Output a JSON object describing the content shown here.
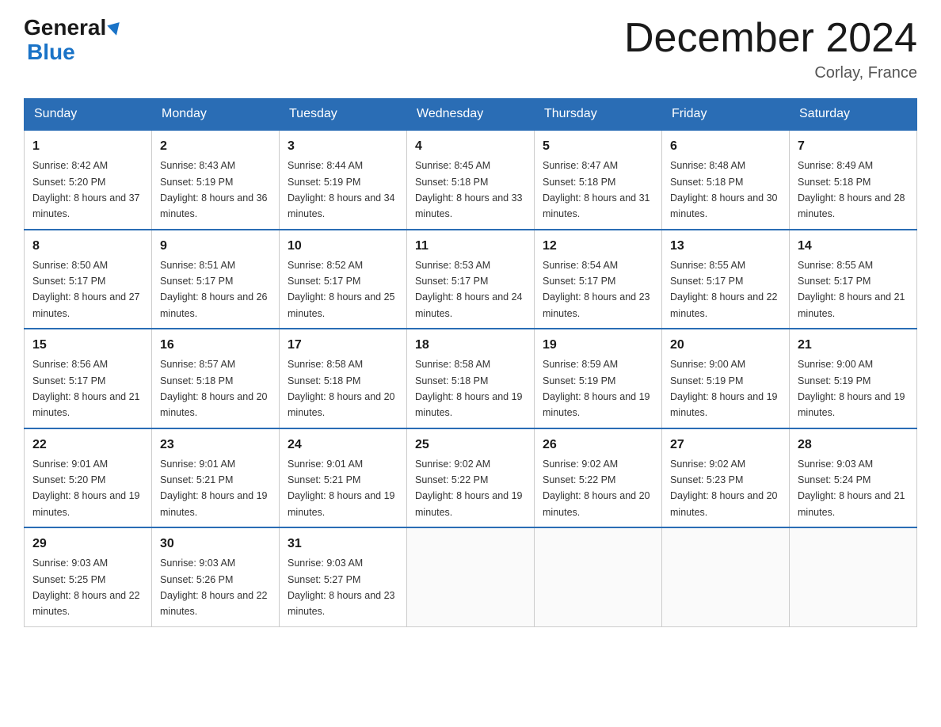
{
  "logo": {
    "general": "General",
    "blue": "Blue"
  },
  "title": "December 2024",
  "location": "Corlay, France",
  "days_header": [
    "Sunday",
    "Monday",
    "Tuesday",
    "Wednesday",
    "Thursday",
    "Friday",
    "Saturday"
  ],
  "weeks": [
    [
      {
        "day": "1",
        "sunrise": "8:42 AM",
        "sunset": "5:20 PM",
        "daylight": "8 hours and 37 minutes."
      },
      {
        "day": "2",
        "sunrise": "8:43 AM",
        "sunset": "5:19 PM",
        "daylight": "8 hours and 36 minutes."
      },
      {
        "day": "3",
        "sunrise": "8:44 AM",
        "sunset": "5:19 PM",
        "daylight": "8 hours and 34 minutes."
      },
      {
        "day": "4",
        "sunrise": "8:45 AM",
        "sunset": "5:18 PM",
        "daylight": "8 hours and 33 minutes."
      },
      {
        "day": "5",
        "sunrise": "8:47 AM",
        "sunset": "5:18 PM",
        "daylight": "8 hours and 31 minutes."
      },
      {
        "day": "6",
        "sunrise": "8:48 AM",
        "sunset": "5:18 PM",
        "daylight": "8 hours and 30 minutes."
      },
      {
        "day": "7",
        "sunrise": "8:49 AM",
        "sunset": "5:18 PM",
        "daylight": "8 hours and 28 minutes."
      }
    ],
    [
      {
        "day": "8",
        "sunrise": "8:50 AM",
        "sunset": "5:17 PM",
        "daylight": "8 hours and 27 minutes."
      },
      {
        "day": "9",
        "sunrise": "8:51 AM",
        "sunset": "5:17 PM",
        "daylight": "8 hours and 26 minutes."
      },
      {
        "day": "10",
        "sunrise": "8:52 AM",
        "sunset": "5:17 PM",
        "daylight": "8 hours and 25 minutes."
      },
      {
        "day": "11",
        "sunrise": "8:53 AM",
        "sunset": "5:17 PM",
        "daylight": "8 hours and 24 minutes."
      },
      {
        "day": "12",
        "sunrise": "8:54 AM",
        "sunset": "5:17 PM",
        "daylight": "8 hours and 23 minutes."
      },
      {
        "day": "13",
        "sunrise": "8:55 AM",
        "sunset": "5:17 PM",
        "daylight": "8 hours and 22 minutes."
      },
      {
        "day": "14",
        "sunrise": "8:55 AM",
        "sunset": "5:17 PM",
        "daylight": "8 hours and 21 minutes."
      }
    ],
    [
      {
        "day": "15",
        "sunrise": "8:56 AM",
        "sunset": "5:17 PM",
        "daylight": "8 hours and 21 minutes."
      },
      {
        "day": "16",
        "sunrise": "8:57 AM",
        "sunset": "5:18 PM",
        "daylight": "8 hours and 20 minutes."
      },
      {
        "day": "17",
        "sunrise": "8:58 AM",
        "sunset": "5:18 PM",
        "daylight": "8 hours and 20 minutes."
      },
      {
        "day": "18",
        "sunrise": "8:58 AM",
        "sunset": "5:18 PM",
        "daylight": "8 hours and 19 minutes."
      },
      {
        "day": "19",
        "sunrise": "8:59 AM",
        "sunset": "5:19 PM",
        "daylight": "8 hours and 19 minutes."
      },
      {
        "day": "20",
        "sunrise": "9:00 AM",
        "sunset": "5:19 PM",
        "daylight": "8 hours and 19 minutes."
      },
      {
        "day": "21",
        "sunrise": "9:00 AM",
        "sunset": "5:19 PM",
        "daylight": "8 hours and 19 minutes."
      }
    ],
    [
      {
        "day": "22",
        "sunrise": "9:01 AM",
        "sunset": "5:20 PM",
        "daylight": "8 hours and 19 minutes."
      },
      {
        "day": "23",
        "sunrise": "9:01 AM",
        "sunset": "5:21 PM",
        "daylight": "8 hours and 19 minutes."
      },
      {
        "day": "24",
        "sunrise": "9:01 AM",
        "sunset": "5:21 PM",
        "daylight": "8 hours and 19 minutes."
      },
      {
        "day": "25",
        "sunrise": "9:02 AM",
        "sunset": "5:22 PM",
        "daylight": "8 hours and 19 minutes."
      },
      {
        "day": "26",
        "sunrise": "9:02 AM",
        "sunset": "5:22 PM",
        "daylight": "8 hours and 20 minutes."
      },
      {
        "day": "27",
        "sunrise": "9:02 AM",
        "sunset": "5:23 PM",
        "daylight": "8 hours and 20 minutes."
      },
      {
        "day": "28",
        "sunrise": "9:03 AM",
        "sunset": "5:24 PM",
        "daylight": "8 hours and 21 minutes."
      }
    ],
    [
      {
        "day": "29",
        "sunrise": "9:03 AM",
        "sunset": "5:25 PM",
        "daylight": "8 hours and 22 minutes."
      },
      {
        "day": "30",
        "sunrise": "9:03 AM",
        "sunset": "5:26 PM",
        "daylight": "8 hours and 22 minutes."
      },
      {
        "day": "31",
        "sunrise": "9:03 AM",
        "sunset": "5:27 PM",
        "daylight": "8 hours and 23 minutes."
      },
      null,
      null,
      null,
      null
    ]
  ]
}
